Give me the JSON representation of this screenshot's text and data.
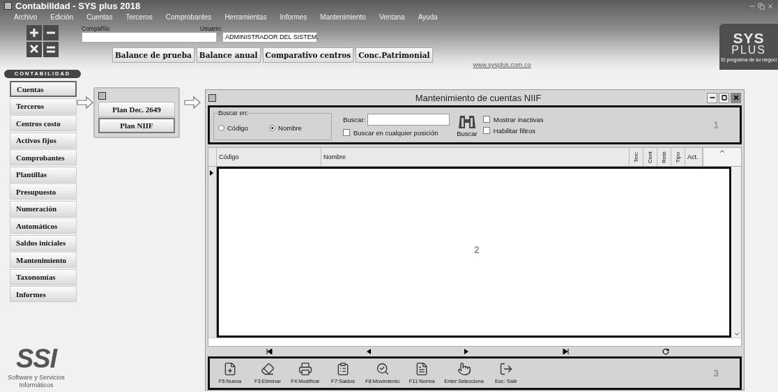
{
  "window": {
    "title": "Contabilidad - SYS plus 2018"
  },
  "menu": [
    "Archivo",
    "Edición",
    "Cuentas",
    "Terceros",
    "Comprobantes",
    "Herramientas",
    "Informes",
    "Mantenimiento",
    "Ventana",
    "Ayuda"
  ],
  "header": {
    "company_label": "Compañía:",
    "user_label": "Usuario:",
    "user_value": "ADMINISTRADOR DEL SISTEM.",
    "buttons": [
      "Balance de prueba",
      "Balance anual",
      "Comparativo centros",
      "Conc.Patrimonial"
    ],
    "link": "www.sysplus.com.co"
  },
  "brand": {
    "line1": "SYS",
    "line2": "PLUS",
    "tagline": "El programa de su negoci"
  },
  "module_label": "CONTABILIDAD",
  "sidebar": {
    "items": [
      {
        "label": "Cuentas",
        "selected": true
      },
      {
        "label": "Terceros",
        "selected": false
      },
      {
        "label": "Centros costo",
        "selected": false
      },
      {
        "label": "Activos fijos",
        "selected": false
      },
      {
        "label": "Comprobantes",
        "selected": false
      },
      {
        "label": "Plantillas",
        "selected": false
      },
      {
        "label": "Presupuesto",
        "selected": false
      },
      {
        "label": "Numeración",
        "selected": false
      },
      {
        "label": "Automáticos",
        "selected": false
      },
      {
        "label": "Saldos iniciales",
        "selected": false
      },
      {
        "label": "Mantenimiento",
        "selected": false
      },
      {
        "label": "Taxonomías",
        "selected": false
      },
      {
        "label": "Informes",
        "selected": false
      }
    ]
  },
  "plan_popup": {
    "items": [
      {
        "label": "Plan Dec. 2649",
        "selected": false
      },
      {
        "label": "Plan NIIF",
        "selected": true
      }
    ]
  },
  "dialog": {
    "title": "Mantenimiento de cuentas NIIF",
    "search": {
      "group_label": "Buscar en:",
      "options": [
        {
          "label": "Código",
          "selected": false
        },
        {
          "label": "Nombre",
          "selected": true
        }
      ],
      "search_label": "Buscar:",
      "position_checkbox": {
        "label": "Buscar en cualquier posición",
        "checked": false
      },
      "search_button": "Buscar",
      "filters": [
        {
          "label": "Mostrar inactivas",
          "checked": false
        },
        {
          "label": "Habilitar filtros",
          "checked": false
        }
      ],
      "marker": "1"
    },
    "grid": {
      "columns": [
        {
          "label": "Código",
          "vertical": false
        },
        {
          "label": "Nombre",
          "vertical": false
        },
        {
          "label": "Terc",
          "vertical": true
        },
        {
          "label": "Cent",
          "vertical": true
        },
        {
          "label": "Rete",
          "vertical": true
        },
        {
          "label": "Tipo",
          "vertical": true
        },
        {
          "label": "Act.",
          "vertical": false
        }
      ],
      "marker": "2"
    },
    "toolbar": {
      "items": [
        "F5:Nueva",
        "F3:Eliminar",
        "F4:Modificar",
        "F7:Saldos",
        "F8:Movimiento",
        "F11:Norma",
        "Enter:Selecciona",
        "Esc: Salir"
      ],
      "marker": "3"
    }
  },
  "footer_logo": {
    "mark": "SSI",
    "caption": "Software y Servicios Informáticos"
  }
}
